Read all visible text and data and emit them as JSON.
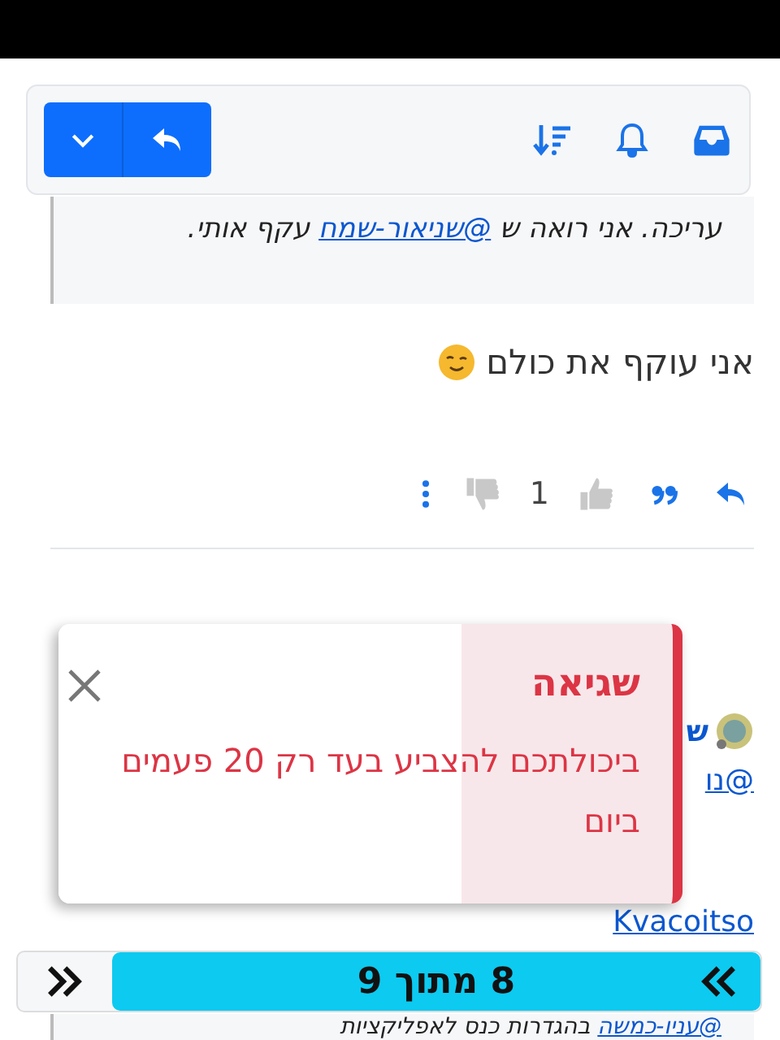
{
  "quote": {
    "before": "עריכה. אני רואה ש ",
    "mention": "@שניאור-שמח",
    "after": " עקף אותי."
  },
  "post": {
    "text": "אני עוקף את כולם"
  },
  "actions": {
    "likes": "1"
  },
  "next_post": {
    "author": "ש",
    "mention": "@נו",
    "line_2": "Kvacoitso"
  },
  "toast": {
    "title": "שגיאה",
    "message": "ביכולתכם להצביע בעד רק 20 פעמים ביום"
  },
  "pager": {
    "label": "8 מתוך 9"
  },
  "bottom_quote": {
    "mention": "@עניו-כמשה",
    "text": " בהגדרות כנס לאפליקציות"
  }
}
